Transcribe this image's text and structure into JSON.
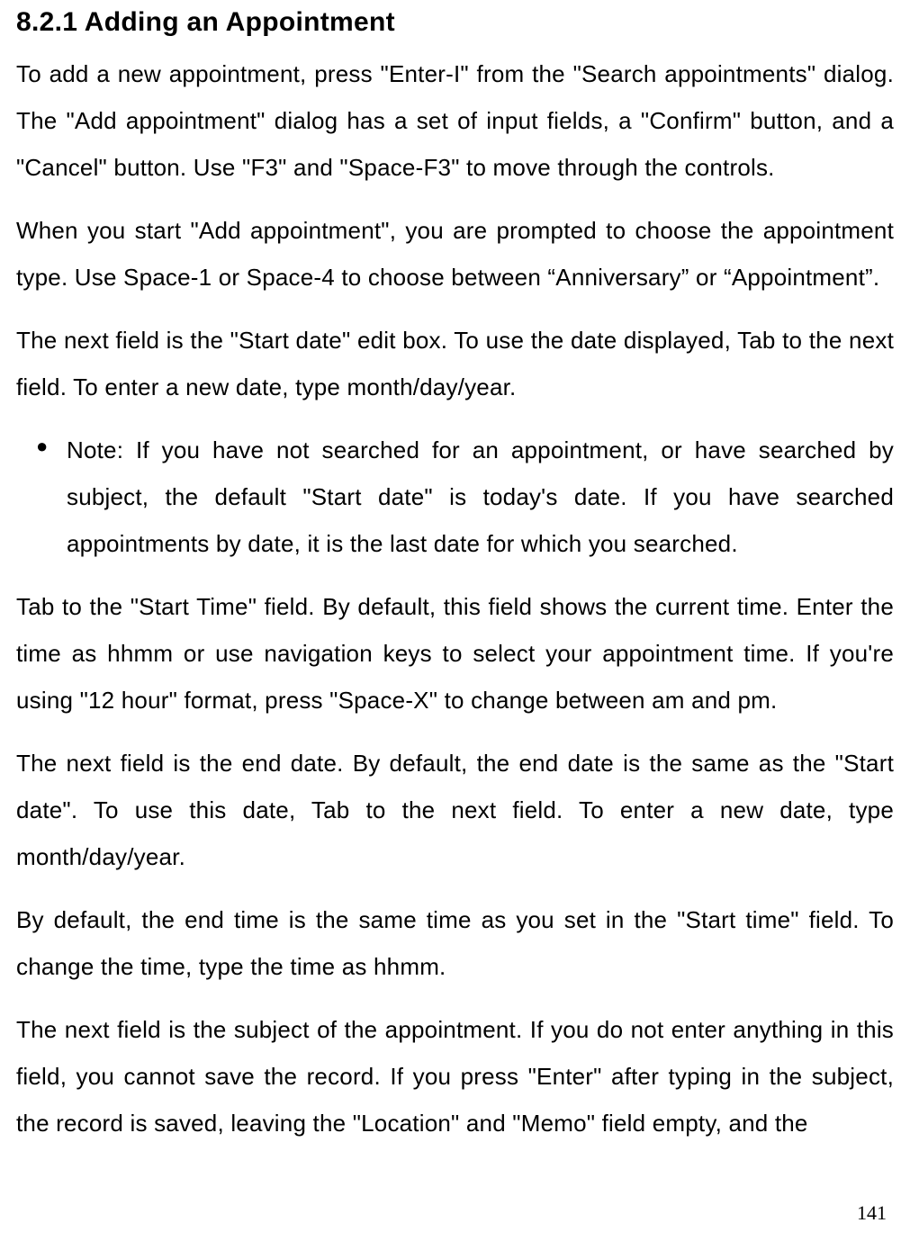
{
  "heading": "8.2.1 Adding an Appointment",
  "paragraphs": {
    "p1": "To add a new appointment, press \"Enter-I\" from the \"Search appointments\" dialog. The \"Add appointment\" dialog has a set of input fields, a \"Confirm\" button, and a \"Cancel\" button. Use \"F3\" and \"Space-F3\" to move through the controls.",
    "p2": "When you start \"Add appointment\", you are prompted to choose the appointment type. Use Space-1 or Space-4 to choose between “Anniversary” or “Appointment”.",
    "p3": "The next field is the \"Start date\" edit box. To use the date displayed, Tab to the next field. To enter a new date, type month/day/year.",
    "note": "Note: If you have not searched for an appointment, or have searched by subject, the default \"Start date\" is today's date. If you have searched appointments by date, it is the last date for which you searched.",
    "p4": "Tab to the \"Start Time\" field. By default, this field shows the current time. Enter the time as hhmm or use navigation keys to select your appointment time. If you're using \"12 hour\" format, press \"Space-X\" to change between am and pm.",
    "p5": "The next field is the end date. By default, the end date is the same as the \"Start date\". To use this date, Tab to the next field. To enter a new date, type month/day/year.",
    "p6": "By default, the end time is the same time as you set in the \"Start time\" field. To change the time, type the time as hhmm.",
    "p7": "The next field is the subject of the appointment. If you do not enter anything in this field, you cannot save the record. If you press \"Enter\" after typing in the subject, the record is saved, leaving the \"Location\" and \"Memo\" field empty, and the"
  },
  "pageNumber": "141"
}
